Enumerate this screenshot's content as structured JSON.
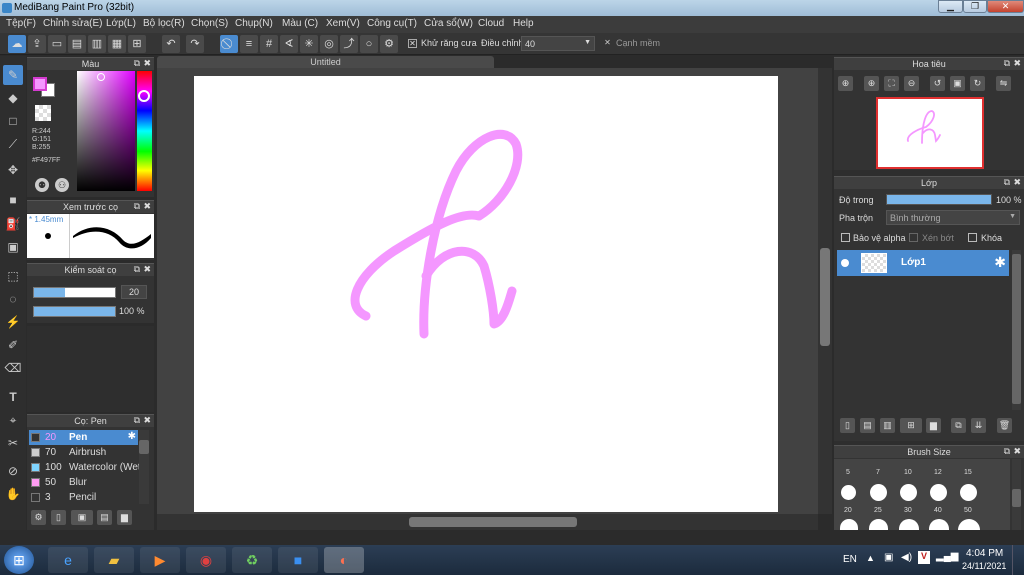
{
  "window": {
    "title": "MediBang Paint Pro (32bit)",
    "min": "▁",
    "max": "❐",
    "close": "✕"
  },
  "menu": [
    "Tệp(F)",
    "Chỉnh sửa(E)",
    "Lớp(L)",
    "Bộ lọc(R)",
    "Chọn(S)",
    "Chụp(N)",
    "Màu (C)",
    "Xem(V)",
    "Công cụ(T)",
    "Cửa sổ(W)",
    "Cloud",
    "Help"
  ],
  "toolbar": {
    "antialias": "Khử răng cưa",
    "adjust_label": "Điều chỉnh",
    "adjust_value": "40",
    "edge": "Cạnh mềm"
  },
  "color_panel": {
    "title": "Màu",
    "r": "R:244",
    "g": "G:151",
    "b": "B:255",
    "hex": "#F497FF",
    "primary": "#F497FF"
  },
  "brush_preview": {
    "title": "Xem trước cọ",
    "size": "* 1.45mm"
  },
  "brush_control": {
    "title": "Kiểm soát cọ",
    "size": "20",
    "opacity": "100 %"
  },
  "brush_list": {
    "title": "Cọ: Pen",
    "items": [
      {
        "n": "20",
        "label": "Pen",
        "color": "#333"
      },
      {
        "n": "70",
        "label": "Airbrush",
        "color": "#ccc"
      },
      {
        "n": "100",
        "label": "Watercolor (Wet)",
        "color": "#7fd4ff"
      },
      {
        "n": "50",
        "label": "Blur",
        "color": "#ff9cf2"
      },
      {
        "n": "3",
        "label": "Pencil",
        "color": "#333"
      }
    ]
  },
  "canvas": {
    "tab": "Untitled",
    "stroke_color": "#F497FF"
  },
  "navigator": {
    "title": "Hoa tiêu"
  },
  "layer_panel": {
    "title": "Lớp",
    "opacity_label": "Độ trong",
    "opacity_value": "100 %",
    "blend_label": "Pha trộn",
    "blend_value": "Bình thường",
    "protect_alpha": "Bảo vệ alpha",
    "clip": "Xén bớt",
    "lock": "Khóa",
    "layer_name": "Lớp1"
  },
  "brush_size": {
    "title": "Brush Size",
    "row1": [
      "5",
      "7",
      "10",
      "12",
      "15"
    ],
    "row2": [
      "20",
      "25",
      "30",
      "40",
      "50"
    ]
  },
  "taskbar": {
    "lang": "EN",
    "time": "4:04 PM",
    "date": "24/11/2021"
  }
}
